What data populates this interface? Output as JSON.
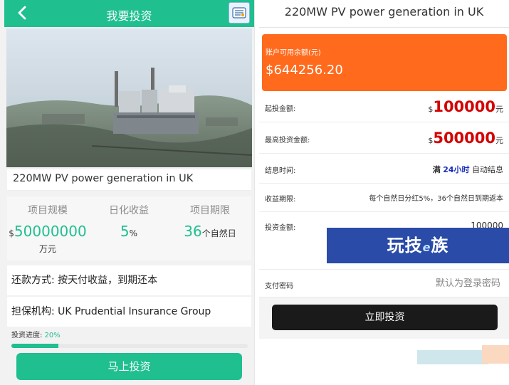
{
  "left": {
    "header": {
      "title": "我要投资"
    },
    "project_name": "220MW PV power generation in UK",
    "stats": [
      {
        "label": "项目规模",
        "prefix": "$",
        "value": "50000000",
        "unit": "万元"
      },
      {
        "label": "日化收益",
        "value": "5",
        "suffix": "%"
      },
      {
        "label": "项目期限",
        "value": "36",
        "suffix": "个自然日"
      }
    ],
    "repayment": "还款方式:  按天付收益，到期还本",
    "guarantor": "担保机构: UK Prudential Insurance Group",
    "progress": {
      "label": "投资进度:",
      "value": "20%",
      "fraction": 0.2
    },
    "invest_button": "马上投资"
  },
  "right": {
    "title": "220MW PV power generation in UK",
    "balance": {
      "label": "账户可用余额(元)",
      "value": "$644256.20"
    },
    "min_invest": {
      "label": "起投金额:",
      "currency": "$",
      "value": "100000",
      "unit": "元"
    },
    "max_invest": {
      "label": "最高投资金额:",
      "currency": "$",
      "value": "500000",
      "unit": "元"
    },
    "settle": {
      "label": "结息时间:",
      "pre": "满",
      "value": "24小时",
      "post": "自动结息"
    },
    "period": {
      "label": "收益期限:",
      "value": "每个自然日分红5%，36个自然日到期返本"
    },
    "amount": {
      "label": "投资金额:",
      "value": "100000"
    },
    "password": {
      "label": "支付密码",
      "placeholder": "默认为登录密码"
    },
    "submit_button": "立即投资",
    "watermark": {
      "pre": "玩技",
      "mid": "e",
      "post": "族"
    }
  },
  "colors": {
    "accent": "#1fbf8f",
    "orange": "#ff6a1c",
    "red": "#d40000",
    "dark_button": "#1a1a1a"
  }
}
